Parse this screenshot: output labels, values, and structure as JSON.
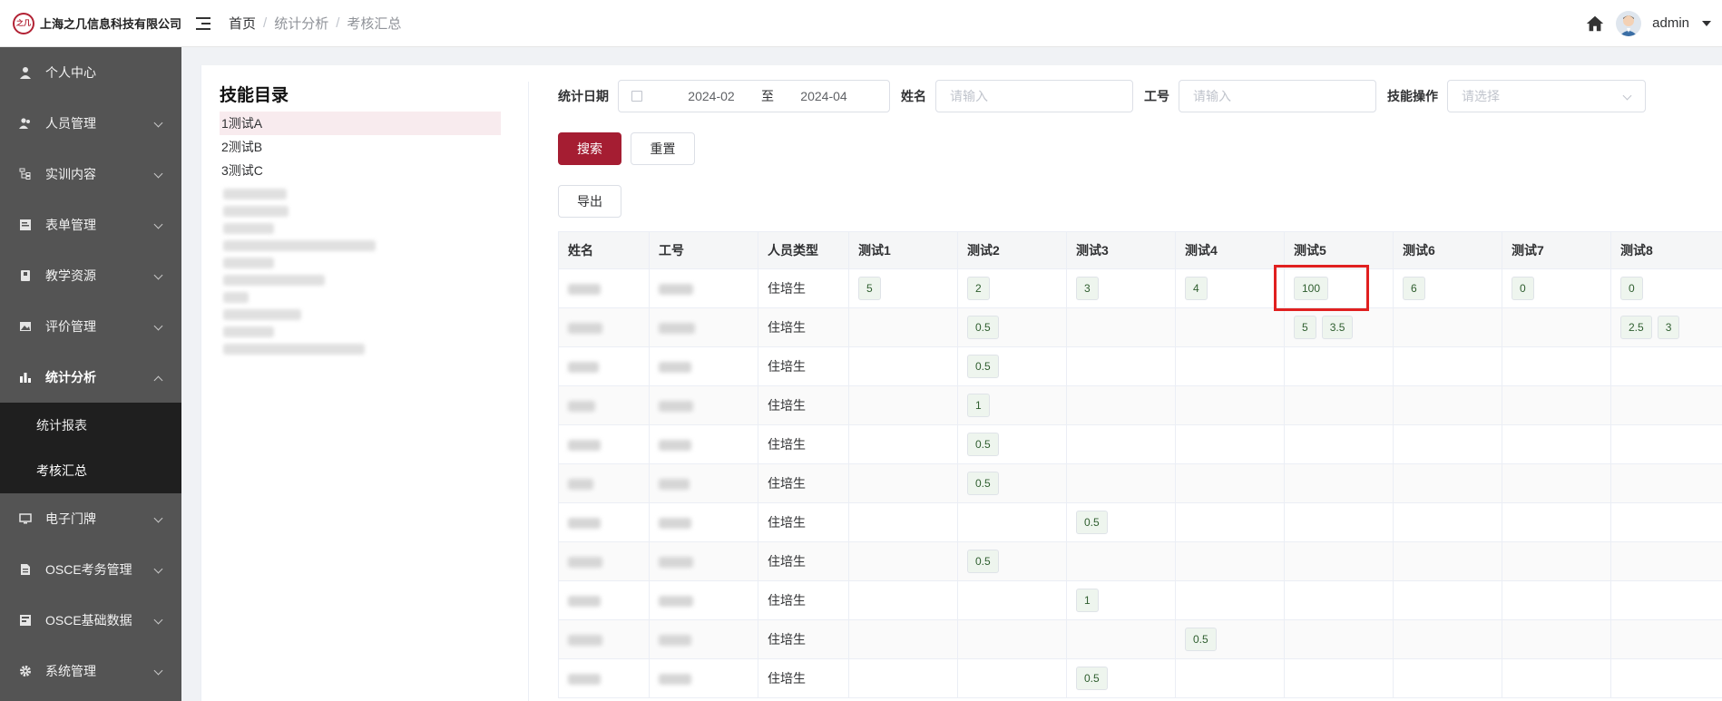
{
  "company": {
    "logo_mark": "之几",
    "name": "上海之几信息科技有限公司"
  },
  "breadcrumb": [
    "首页",
    "统计分析",
    "考核汇总"
  ],
  "user": {
    "name": "admin"
  },
  "sidebar": {
    "items": [
      {
        "label": "个人中心",
        "icon": "user-icon",
        "expandable": false
      },
      {
        "label": "人员管理",
        "icon": "users-icon",
        "expandable": true
      },
      {
        "label": "实训内容",
        "icon": "tree-icon",
        "expandable": true
      },
      {
        "label": "表单管理",
        "icon": "form-icon",
        "expandable": true
      },
      {
        "label": "教学资源",
        "icon": "book-icon",
        "expandable": true
      },
      {
        "label": "评价管理",
        "icon": "image-icon",
        "expandable": true
      },
      {
        "label": "统计分析",
        "icon": "bar-chart-icon",
        "expandable": true,
        "expanded": true
      },
      {
        "label": "电子门牌",
        "icon": "monitor-icon",
        "expandable": true
      },
      {
        "label": "OSCE考务管理",
        "icon": "doc-icon",
        "expandable": true
      },
      {
        "label": "OSCE基础数据",
        "icon": "data-icon",
        "expandable": true
      },
      {
        "label": "系统管理",
        "icon": "gear-icon",
        "expandable": true
      }
    ],
    "submenu": [
      "统计报表",
      "考核汇总"
    ],
    "submenu_selected": "考核汇总"
  },
  "skill_directory": {
    "title": "技能目录",
    "items": [
      "1测试A",
      "2测试B",
      "3测试C"
    ],
    "selected": "1测试A"
  },
  "filters": {
    "date_label": "统计日期",
    "date_start": "2024-02",
    "date_sep": "至",
    "date_end": "2024-04",
    "name_label": "姓名",
    "name_placeholder": "请输入",
    "id_label": "工号",
    "id_placeholder": "请输入",
    "op_label": "技能操作",
    "op_placeholder": "请选择"
  },
  "buttons": {
    "search": "搜索",
    "reset": "重置",
    "export": "导出"
  },
  "table": {
    "headers": [
      "姓名",
      "工号",
      "人员类型",
      "测试1",
      "测试2",
      "测试3",
      "测试4",
      "测试5",
      "测试6",
      "测试7",
      "测试8"
    ],
    "rows": [
      {
        "type": "住培生",
        "scores": [
          [
            "5"
          ],
          [
            "2"
          ],
          [
            "3"
          ],
          [
            "4"
          ],
          [
            "100"
          ],
          [
            "6"
          ],
          [
            "0"
          ],
          [
            "0"
          ]
        ]
      },
      {
        "type": "住培生",
        "scores": [
          [],
          [
            "0.5"
          ],
          [],
          [],
          [
            "5",
            "3.5"
          ],
          [],
          [],
          [
            "2.5",
            "3"
          ]
        ]
      },
      {
        "type": "住培生",
        "scores": [
          [],
          [
            "0.5"
          ],
          [],
          [],
          [],
          [],
          [],
          []
        ]
      },
      {
        "type": "住培生",
        "scores": [
          [],
          [
            "1"
          ],
          [],
          [],
          [],
          [],
          [],
          []
        ]
      },
      {
        "type": "住培生",
        "scores": [
          [],
          [
            "0.5"
          ],
          [],
          [],
          [],
          [],
          [],
          []
        ]
      },
      {
        "type": "住培生",
        "scores": [
          [],
          [
            "0.5"
          ],
          [],
          [],
          [],
          [],
          [],
          []
        ]
      },
      {
        "type": "住培生",
        "scores": [
          [],
          [],
          [
            "0.5"
          ],
          [],
          [],
          [],
          [],
          []
        ]
      },
      {
        "type": "住培生",
        "scores": [
          [],
          [
            "0.5"
          ],
          [],
          [],
          [],
          [],
          [],
          []
        ]
      },
      {
        "type": "住培生",
        "scores": [
          [],
          [],
          [
            "1"
          ],
          [],
          [],
          [],
          [],
          []
        ]
      },
      {
        "type": "住培生",
        "scores": [
          [],
          [],
          [],
          [
            "0.5"
          ],
          [],
          [],
          [],
          []
        ]
      },
      {
        "type": "住培生",
        "scores": [
          [],
          [],
          [
            "0.5"
          ],
          [],
          [],
          [],
          [],
          []
        ]
      }
    ]
  },
  "colors": {
    "primary": "#a51d32",
    "sidebar_bg": "#545454",
    "submenu_bg": "#1f1f1f",
    "highlight": "#e02020"
  }
}
